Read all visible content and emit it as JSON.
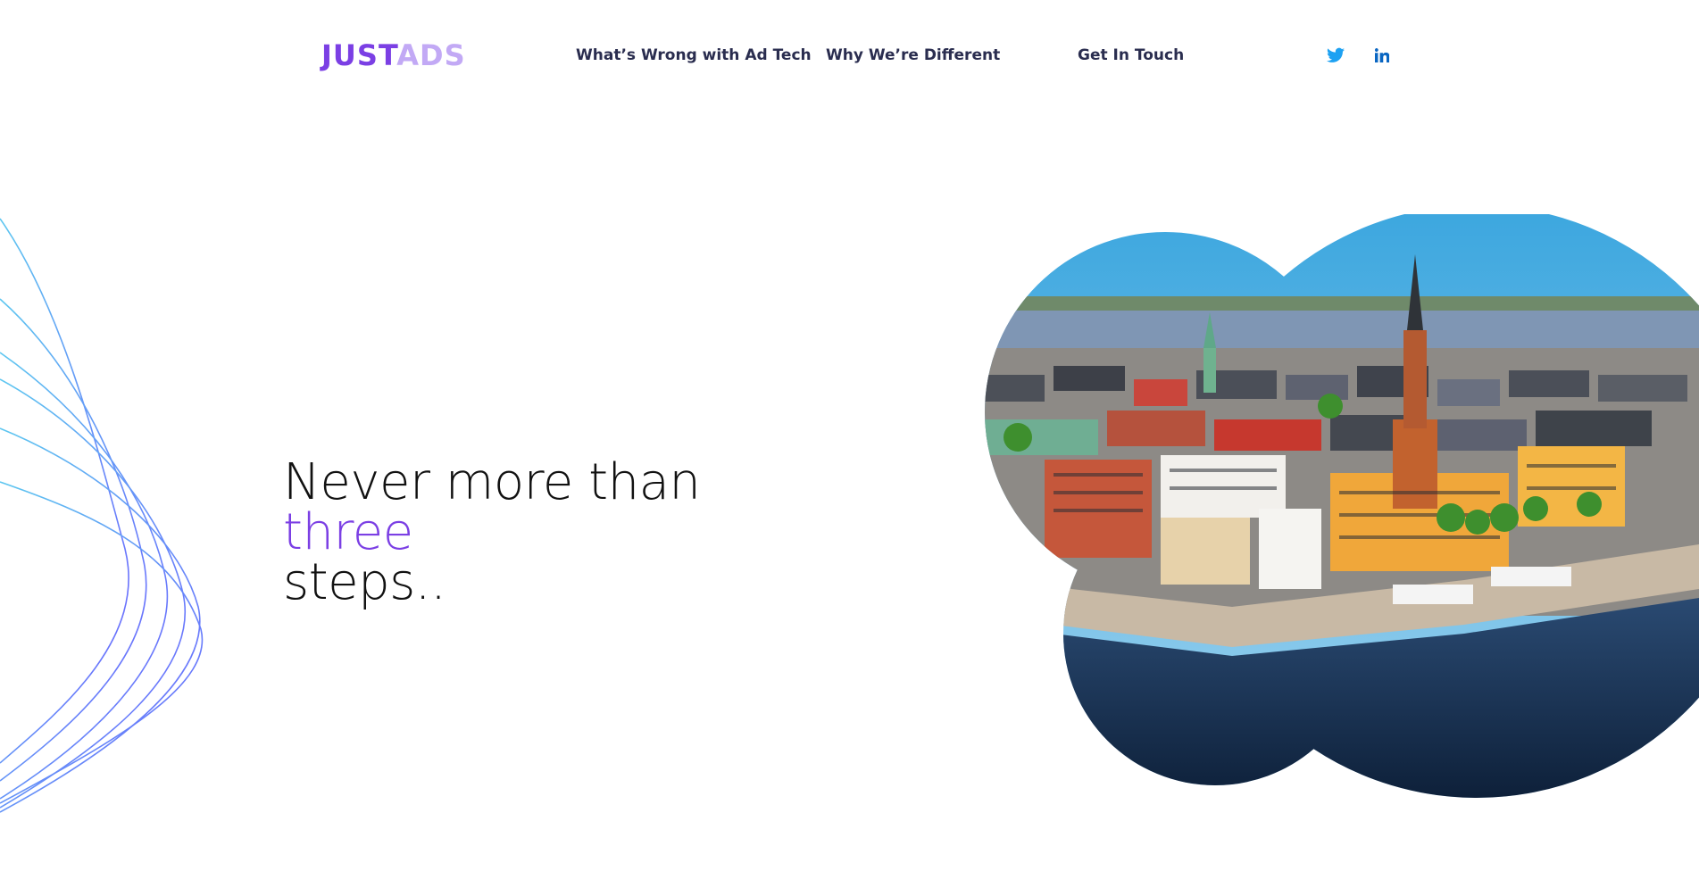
{
  "header": {
    "logo_part1": "JUST",
    "logo_part2": "ADS",
    "nav": [
      {
        "label": "What’s Wrong with Ad Tech"
      },
      {
        "label": "Why We’re Different"
      },
      {
        "label": "Get In Touch"
      }
    ],
    "social": [
      {
        "icon": "twitter-icon",
        "color": "#1da1f2"
      },
      {
        "icon": "linkedin-icon",
        "color": "#0a66c2"
      }
    ]
  },
  "hero": {
    "line1": "Never more than",
    "line2": "three",
    "line3": "steps.."
  },
  "colors": {
    "accent": "#7b3fe4",
    "accent_light": "#c2a9f5",
    "nav_text": "#2a2d4f",
    "wave_start": "#5ec7f0",
    "wave_end": "#6c63ff"
  }
}
